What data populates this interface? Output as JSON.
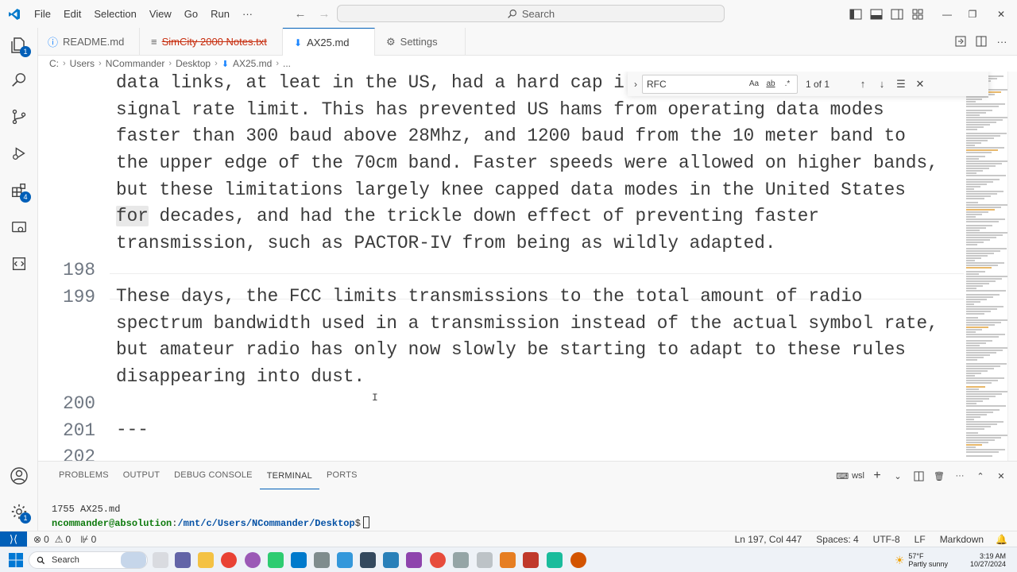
{
  "titlebar": {
    "menu": [
      "File",
      "Edit",
      "Selection",
      "View",
      "Go",
      "Run",
      "···"
    ],
    "search_label": "Search"
  },
  "activity_badges": {
    "source_control": "1",
    "extensions": "4",
    "settings": "1"
  },
  "tabs": [
    {
      "label": "README.md",
      "state": "normal"
    },
    {
      "label": "SimCity 2000 Notes.txt",
      "state": "modified"
    },
    {
      "label": "AX25.md",
      "state": "active-unsaved"
    },
    {
      "label": "Settings",
      "state": "normal"
    }
  ],
  "breadcrumb": [
    "C:",
    "Users",
    "NCommander",
    "Desktop",
    "AX25.md",
    "..."
  ],
  "editor": {
    "lines": [
      {
        "number": "",
        "text": "data links, at leat in the US, had a hard cap i"
      },
      {
        "number": "",
        "text": "signal rate limit. This has prevented US hams from operating data modes"
      },
      {
        "number": "",
        "text": "faster than 300 baud above 28Mhz, and 1200 baud from the 10 meter band to"
      },
      {
        "number": "",
        "text": "the upper edge of the 70cm band. Faster speeds were allowed on higher bands,"
      },
      {
        "number": "",
        "text": "but these limitations largely knee capped data modes in the United States"
      },
      {
        "number": "",
        "text_highlight": "for",
        "text": " decades, and had the trickle down effect of preventing faster"
      },
      {
        "number": "",
        "text": "transmission, such as PACTOR-IV from being as wildly adapted."
      },
      {
        "number": "198",
        "text": ""
      },
      {
        "number": "199",
        "text": "These days, the FCC limits transmissions to the total amount of radio"
      },
      {
        "number": "",
        "text": "spectrum bandwidth used in a transmission instead of the actual symbol rate,"
      },
      {
        "number": "",
        "text": "but amateur radio has only now slowly be starting to adapt to these rules"
      },
      {
        "number": "",
        "text": "disappearing into dust."
      },
      {
        "number": "200",
        "text": ""
      },
      {
        "number": "201",
        "text": "---"
      },
      {
        "number": "202",
        "text": ""
      }
    ]
  },
  "find": {
    "query": "RFC",
    "match_case": "Aa",
    "whole_word": "ab",
    "regex": ".*",
    "count": "1 of 1"
  },
  "panel": {
    "tabs": [
      "PROBLEMS",
      "OUTPUT",
      "DEBUG CONSOLE",
      "TERMINAL",
      "PORTS"
    ],
    "active_tab": "TERMINAL",
    "shell": "wsl",
    "terminal": {
      "line1": "1755 AX25.md",
      "user": "ncommander@absolution",
      "sep": ":",
      "path": "/mnt/c/Users/NCommander/Desktop",
      "prompt": "$"
    }
  },
  "statusbar": {
    "errors": "0",
    "warnings": "0",
    "ports": "0",
    "position": "Ln 197, Col 447",
    "spaces": "Spaces: 4",
    "encoding": "UTF-8",
    "eol": "LF",
    "language": "Markdown"
  },
  "taskbar": {
    "search_label": "Search",
    "weather_temp": "57°F",
    "weather_desc": "Partly sunny",
    "time": "3:19 AM",
    "date": "10/27/2024"
  },
  "colors": {
    "accent": "#005fb8",
    "modified_tab": "#c72e0f",
    "terminal_user": "#0e7a0d",
    "terminal_path": "#0451a5"
  }
}
